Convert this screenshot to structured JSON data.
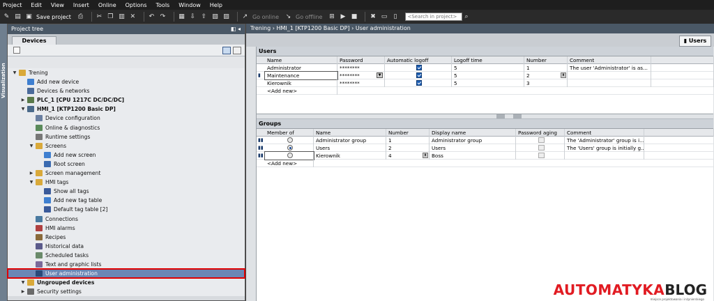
{
  "menubar": [
    "Project",
    "Edit",
    "View",
    "Insert",
    "Online",
    "Options",
    "Tools",
    "Window",
    "Help"
  ],
  "toolbar": {
    "save_label": "Save project",
    "go_online": "Go online",
    "go_offline": "Go offline",
    "search_placeholder": "<Search in project>"
  },
  "sidebar": {
    "vertical_label": "Visualization"
  },
  "project_tree": {
    "title": "Project tree",
    "devices_tab": "Devices",
    "items": [
      {
        "label": "Trening",
        "level": 0,
        "arrow": "down",
        "icon": "folder",
        "bold": false
      },
      {
        "label": "Add new device",
        "level": 1,
        "arrow": "",
        "icon": "add",
        "bold": false
      },
      {
        "label": "Devices & networks",
        "level": 1,
        "arrow": "",
        "icon": "network",
        "bold": false
      },
      {
        "label": "PLC_1 [CPU 1217C DC/DC/DC]",
        "level": 1,
        "arrow": "right",
        "icon": "plc",
        "bold": true
      },
      {
        "label": "HMI_1 [KTP1200 Basic DP]",
        "level": 1,
        "arrow": "down",
        "icon": "hmi",
        "bold": true
      },
      {
        "label": "Device configuration",
        "level": 2,
        "arrow": "",
        "icon": "config",
        "bold": false
      },
      {
        "label": "Online & diagnostics",
        "level": 2,
        "arrow": "",
        "icon": "diag",
        "bold": false
      },
      {
        "label": "Runtime settings",
        "level": 2,
        "arrow": "",
        "icon": "settings",
        "bold": false
      },
      {
        "label": "Screens",
        "level": 2,
        "arrow": "down",
        "icon": "folder",
        "bold": false
      },
      {
        "label": "Add new screen",
        "level": 3,
        "arrow": "",
        "icon": "add",
        "bold": false
      },
      {
        "label": "Root screen",
        "level": 3,
        "arrow": "",
        "icon": "screen",
        "bold": false
      },
      {
        "label": "Screen management",
        "level": 2,
        "arrow": "right",
        "icon": "folder",
        "bold": false
      },
      {
        "label": "HMI tags",
        "level": 2,
        "arrow": "down",
        "icon": "folder",
        "bold": false
      },
      {
        "label": "Show all tags",
        "level": 3,
        "arrow": "",
        "icon": "tags",
        "bold": false
      },
      {
        "label": "Add new tag table",
        "level": 3,
        "arrow": "",
        "icon": "add",
        "bold": false
      },
      {
        "label": "Default tag table [2]",
        "level": 3,
        "arrow": "",
        "icon": "tags",
        "bold": false
      },
      {
        "label": "Connections",
        "level": 2,
        "arrow": "",
        "icon": "connections",
        "bold": false
      },
      {
        "label": "HMI alarms",
        "level": 2,
        "arrow": "",
        "icon": "alarms",
        "bold": false
      },
      {
        "label": "Recipes",
        "level": 2,
        "arrow": "",
        "icon": "recipes",
        "bold": false
      },
      {
        "label": "Historical data",
        "level": 2,
        "arrow": "",
        "icon": "history",
        "bold": false
      },
      {
        "label": "Scheduled tasks",
        "level": 2,
        "arrow": "",
        "icon": "tasks",
        "bold": false
      },
      {
        "label": "Text and graphic lists",
        "level": 2,
        "arrow": "",
        "icon": "lists",
        "bold": false
      },
      {
        "label": "User administration",
        "level": 2,
        "arrow": "",
        "icon": "users",
        "bold": false,
        "selected": true
      },
      {
        "label": "Ungrouped devices",
        "level": 1,
        "arrow": "down",
        "icon": "folder",
        "bold": true
      },
      {
        "label": "Security settings",
        "level": 1,
        "arrow": "right",
        "icon": "security",
        "bold": false
      }
    ]
  },
  "breadcrumb": [
    "Trening",
    "HMI_1 [KTP1200 Basic DP]",
    "User administration"
  ],
  "users_tab": "Users",
  "users": {
    "title": "Users",
    "columns": [
      "Name",
      "Password",
      "Automatic logoff",
      "Logoff time",
      "Number",
      "Comment"
    ],
    "rows": [
      {
        "name": "Administrator",
        "password": "********",
        "auto_logoff": true,
        "logoff_time": "5",
        "number": "1",
        "comment": "The user 'Administrator' is as..."
      },
      {
        "name": "Maintenance",
        "password": "********",
        "auto_logoff": true,
        "logoff_time": "5",
        "number": "2",
        "comment": ""
      },
      {
        "name": "Kierownik",
        "password": "********",
        "auto_logoff": true,
        "logoff_time": "5",
        "number": "3",
        "comment": ""
      }
    ],
    "add_new": "<Add new>"
  },
  "groups": {
    "title": "Groups",
    "columns": [
      "Member of",
      "Name",
      "Number",
      "Display name",
      "Password aging",
      "Comment"
    ],
    "rows": [
      {
        "member": false,
        "name": "Administrator group",
        "number": "1",
        "display": "Administrator group",
        "comment": "The 'Administrator' group is i..."
      },
      {
        "member": true,
        "name": "Users",
        "number": "2",
        "display": "Users",
        "comment": "The 'Users' group is initially g..."
      },
      {
        "member": false,
        "name": "Kierownik",
        "number": "4",
        "display": "Boss",
        "comment": ""
      }
    ],
    "add_new": "<Add new>"
  },
  "watermark": {
    "word1": "AUTOMATYKA",
    "word2": "BLOG",
    "tagline": "miejsce projektowania i inżynierskiego"
  },
  "colors": {
    "accent": "#1e5fb4",
    "selection": "#6b87b5",
    "highlight_outline": "#e00000",
    "header": "#4a5866"
  }
}
